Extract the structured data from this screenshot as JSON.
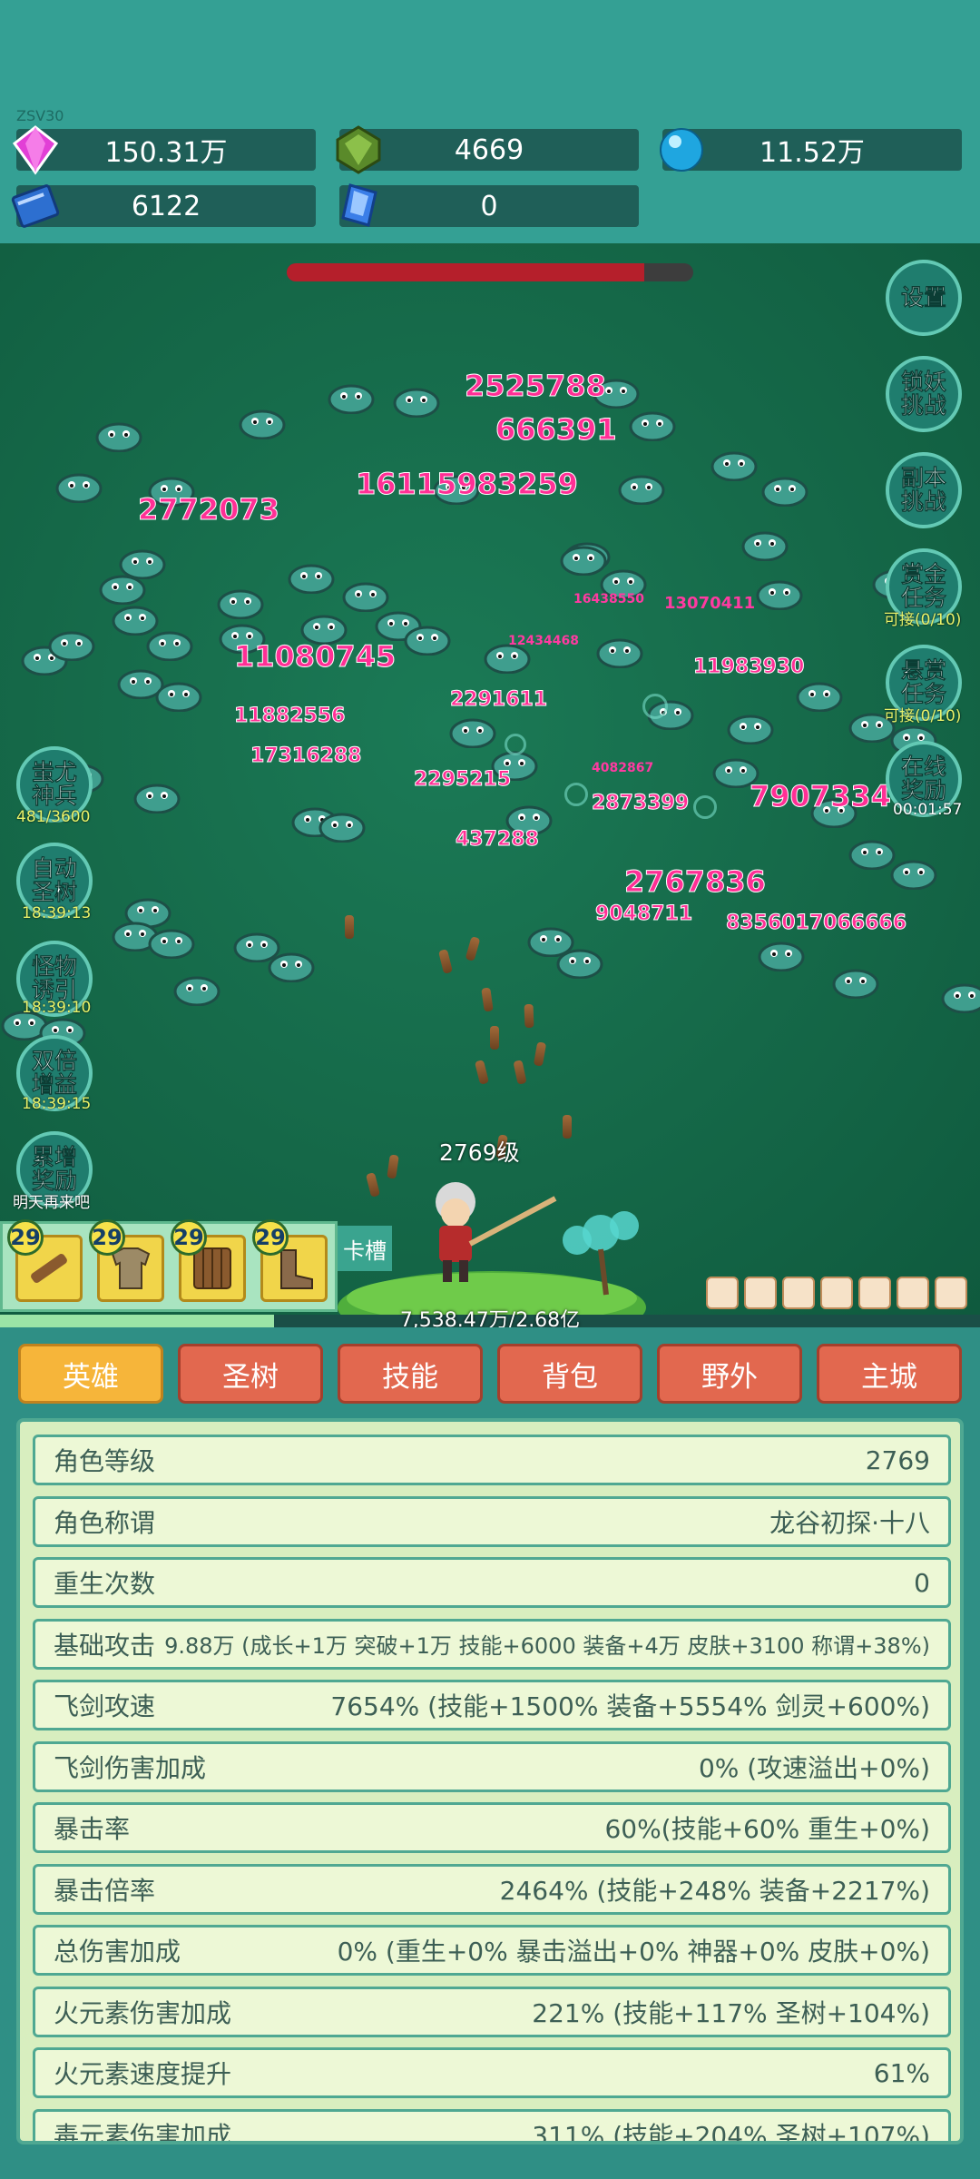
{
  "header": {
    "version": "ZSV30",
    "resources": {
      "gem": "150.31万",
      "green_crystal": "4669",
      "orb": "11.52万",
      "book": "6122",
      "blue_crystal": "0"
    }
  },
  "battle": {
    "boss_hp_fraction": 0.88,
    "hero_level": "2769级",
    "damage_numbers": [
      "2525788",
      "666391",
      "16115983259",
      "2772073",
      "11080745",
      "11882556",
      "17316288",
      "2291611",
      "11983930",
      "13070411",
      "7907334",
      "2873399",
      "2295215",
      "437288",
      "2767836",
      "9048711",
      "8356017066666",
      "16438550",
      "12434468",
      "4082867"
    ],
    "side_left": [
      {
        "label": "蚩尤神兵",
        "sub": "481/3600"
      },
      {
        "label": "自动圣树",
        "sub": "18:39:13"
      },
      {
        "label": "怪物诱引",
        "sub": "18:39:10"
      },
      {
        "label": "双倍增益",
        "sub": "18:39:15"
      },
      {
        "label": "累增奖励",
        "sub": "明天再来吧"
      }
    ],
    "side_right": [
      {
        "label": "设置",
        "sub": ""
      },
      {
        "label": "锁妖挑战",
        "sub": ""
      },
      {
        "label": "副本挑战",
        "sub": ""
      },
      {
        "label": "赏金任务",
        "sub": "可接(0/10)"
      },
      {
        "label": "悬赏任务",
        "sub": "可接(0/10)"
      },
      {
        "label": "在线奖励",
        "sub": "00:01:57"
      }
    ],
    "card_slot_label": "卡槽",
    "slots": [
      "29",
      "29",
      "29",
      "29"
    ],
    "exp_text": "7,538.47万/2.68亿",
    "exp_fraction": 0.28
  },
  "tabs": [
    "英雄",
    "圣树",
    "技能",
    "背包",
    "野外",
    "主城"
  ],
  "stats": [
    {
      "name": "角色等级",
      "value": "2769"
    },
    {
      "name": "角色称谓",
      "value": "龙谷初探·十八"
    },
    {
      "name": "重生次数",
      "value": "0"
    },
    {
      "name": "基础攻击",
      "value": "9.88万 (成长+1万 突破+1万 技能+6000 装备+4万 皮肤+3100 称谓+38%)"
    },
    {
      "name": "飞剑攻速",
      "value": "7654% (技能+1500% 装备+5554% 剑灵+600%)"
    },
    {
      "name": "飞剑伤害加成",
      "value": "0% (攻速溢出+0%)"
    },
    {
      "name": "暴击率",
      "value": "60%(技能+60% 重生+0%)"
    },
    {
      "name": "暴击倍率",
      "value": "2464% (技能+248% 装备+2217%)"
    },
    {
      "name": "总伤害加成",
      "value": "0% (重生+0% 暴击溢出+0% 神器+0% 皮肤+0%)"
    },
    {
      "name": "火元素伤害加成",
      "value": "221% (技能+117% 圣树+104%)"
    },
    {
      "name": "火元素速度提升",
      "value": "61%"
    },
    {
      "name": "毒元素伤害加成",
      "value": "311% (技能+204% 圣树+107%)"
    }
  ]
}
